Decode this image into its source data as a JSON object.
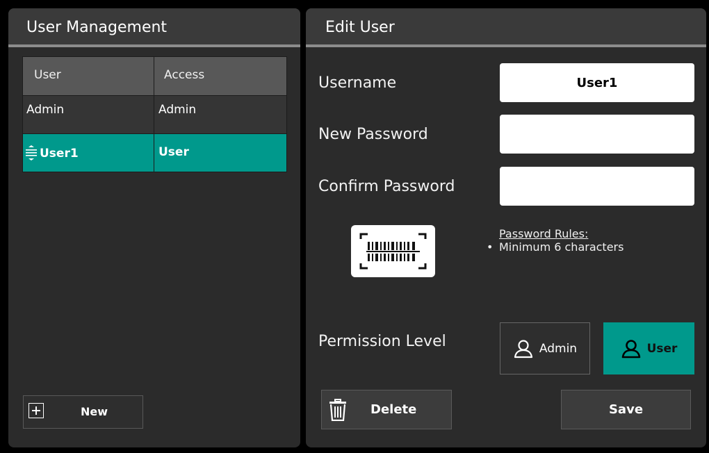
{
  "left_panel": {
    "title": "User Management",
    "table": {
      "headers": [
        "User",
        "Access"
      ],
      "rows": [
        {
          "user": "Admin",
          "access": "Admin"
        },
        {
          "user": "User1",
          "access": "User"
        }
      ],
      "selected_index": 1
    },
    "new_label": "New"
  },
  "right_panel": {
    "title": "Edit User",
    "username_label": "Username",
    "username_value": "User1",
    "new_password_label": "New Password",
    "new_password_value": "",
    "confirm_password_label": "Confirm Password",
    "confirm_password_value": "",
    "barcode_icon": "barcode-scan-icon",
    "rules_title": "Password Rules:",
    "rules": [
      "Minimum 6 characters"
    ],
    "permission_label": "Permission Level",
    "permission_options": [
      "Admin",
      "User"
    ],
    "permission_selected": "User",
    "delete_label": "Delete",
    "save_label": "Save"
  },
  "colors": {
    "accent": "#00998c",
    "panel": "#2b2b2b",
    "header": "#3a3a3a"
  },
  "icons": {
    "row": "reorder-icon",
    "new": "add-box-icon",
    "permission": "person-icon",
    "delete": "trash-icon"
  }
}
